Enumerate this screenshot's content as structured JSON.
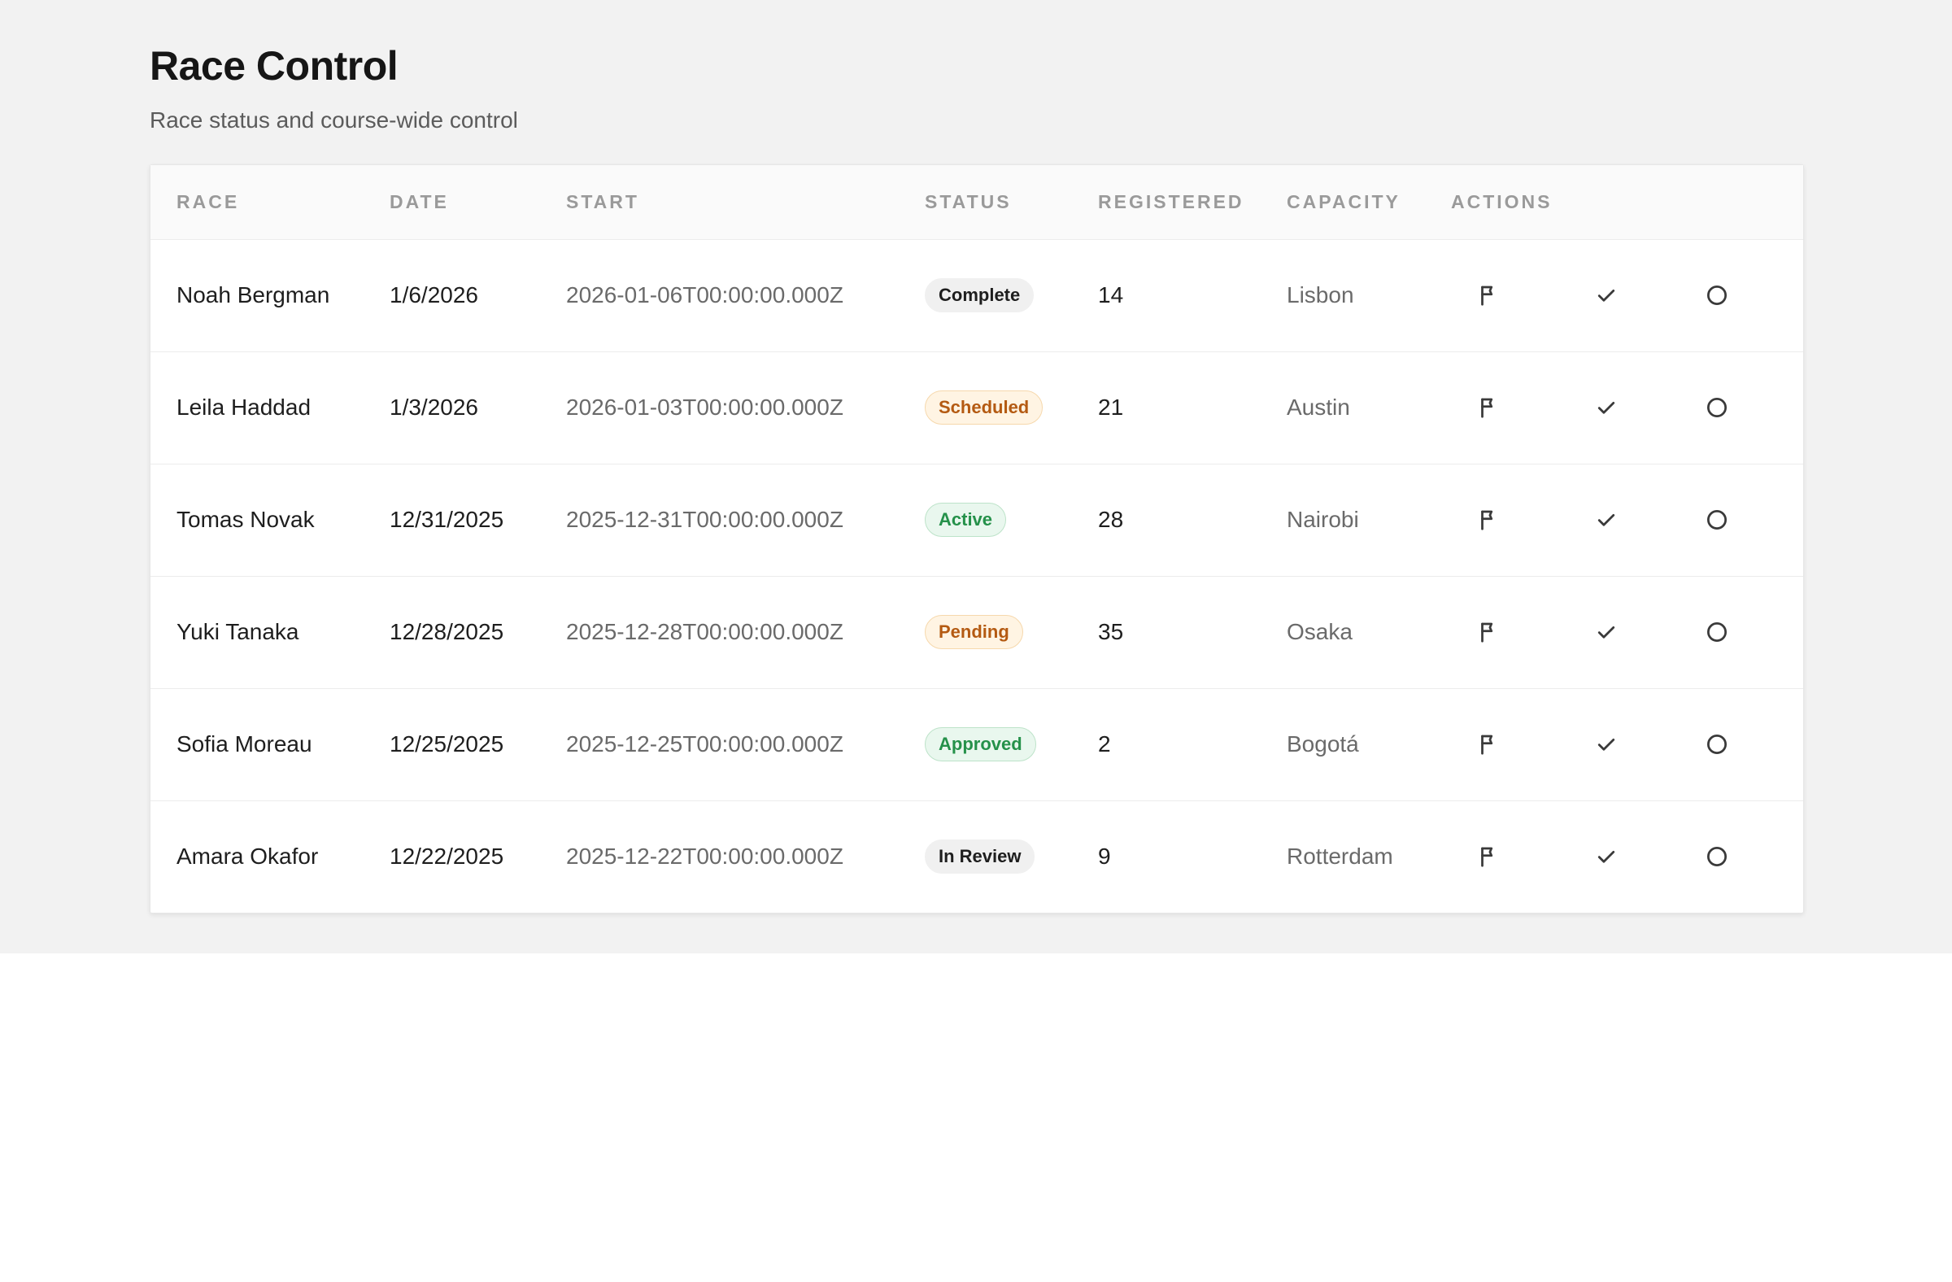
{
  "header": {
    "title": "Race Control",
    "subtitle": "Race status and course-wide control"
  },
  "table": {
    "columns": {
      "race": "RACE",
      "date": "DATE",
      "start": "START",
      "status": "STATUS",
      "registered": "REGISTERED",
      "capacity": "CAPACITY",
      "actions": "ACTIONS"
    },
    "action_icons": [
      "flag-icon",
      "check-icon",
      "circle-icon"
    ],
    "status_colors": {
      "neutral": "#f0f0f0",
      "warning": "#b45a12",
      "success": "#25914a"
    },
    "rows": [
      {
        "race": "Noah Bergman",
        "date": "1/6/2026",
        "start": "2026-01-06T00:00:00.000Z",
        "status": "Complete",
        "status_tone": "neutral",
        "registered": "14",
        "capacity": "Lisbon"
      },
      {
        "race": "Leila Haddad",
        "date": "1/3/2026",
        "start": "2026-01-03T00:00:00.000Z",
        "status": "Scheduled",
        "status_tone": "warning",
        "registered": "21",
        "capacity": "Austin"
      },
      {
        "race": "Tomas Novak",
        "date": "12/31/2025",
        "start": "2025-12-31T00:00:00.000Z",
        "status": "Active",
        "status_tone": "success",
        "registered": "28",
        "capacity": "Nairobi"
      },
      {
        "race": "Yuki Tanaka",
        "date": "12/28/2025",
        "start": "2025-12-28T00:00:00.000Z",
        "status": "Pending",
        "status_tone": "warning",
        "registered": "35",
        "capacity": "Osaka"
      },
      {
        "race": "Sofia Moreau",
        "date": "12/25/2025",
        "start": "2025-12-25T00:00:00.000Z",
        "status": "Approved",
        "status_tone": "success",
        "registered": "2",
        "capacity": "Bogotá"
      },
      {
        "race": "Amara Okafor",
        "date": "12/22/2025",
        "start": "2025-12-22T00:00:00.000Z",
        "status": "In Review",
        "status_tone": "neutral",
        "registered": "9",
        "capacity": "Rotterdam"
      }
    ]
  }
}
